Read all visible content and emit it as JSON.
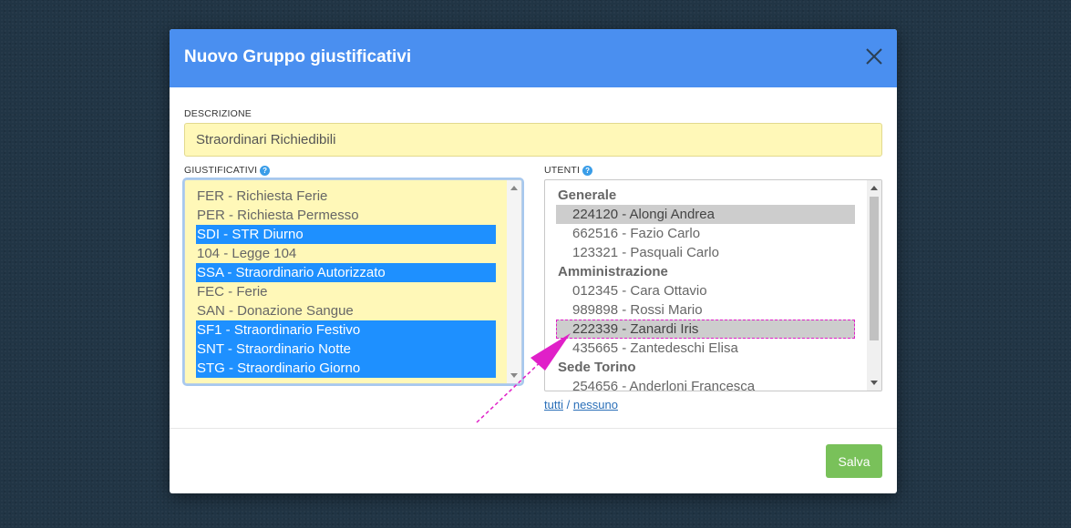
{
  "modal": {
    "title": "Nuovo Gruppo giustificativi"
  },
  "descrizione": {
    "label": "DESCRIZIONE",
    "value": "Straordinari Richiedibili"
  },
  "giustificativi": {
    "label": "GIUSTIFICATIVI",
    "options": [
      {
        "text": "FER - Richiesta Ferie",
        "selected": false
      },
      {
        "text": "PER - Richiesta Permesso",
        "selected": false
      },
      {
        "text": "SDI - STR Diurno",
        "selected": true
      },
      {
        "text": "104 - Legge 104",
        "selected": false
      },
      {
        "text": "SSA - Straordinario Autorizzato",
        "selected": true
      },
      {
        "text": "FEC - Ferie",
        "selected": false
      },
      {
        "text": "SAN - Donazione Sangue",
        "selected": false
      },
      {
        "text": "SF1 - Straordinario Festivo",
        "selected": true
      },
      {
        "text": "SNT - Straordinario Notte",
        "selected": true
      },
      {
        "text": "STG - Straordinario Giorno",
        "selected": true
      }
    ]
  },
  "utenti": {
    "label": "UTENTI",
    "groups": [
      {
        "name": "Generale",
        "users": [
          {
            "text": "224120 - Alongi Andrea",
            "selected": true
          },
          {
            "text": "662516 - Fazio Carlo",
            "selected": false
          },
          {
            "text": "123321 - Pasquali Carlo",
            "selected": false
          }
        ]
      },
      {
        "name": "Amministrazione",
        "users": [
          {
            "text": "012345 - Cara Ottavio",
            "selected": false
          },
          {
            "text": "989898 - Rossi Mario",
            "selected": false
          },
          {
            "text": "222339 - Zanardi Iris",
            "selected": true,
            "highlighted": true
          },
          {
            "text": "435665 - Zantedeschi Elisa",
            "selected": false
          }
        ]
      },
      {
        "name": "Sede Torino",
        "users": [
          {
            "text": "254656 - Anderloni Francesca",
            "selected": false
          }
        ]
      }
    ],
    "select_all": "tutti",
    "separator": "/",
    "select_none": "nessuno"
  },
  "footer": {
    "save_label": "Salva"
  },
  "colors": {
    "header": "#4a8ff0",
    "selection": "#1e90ff",
    "input_bg": "#fff8b8",
    "save_button": "#79c15a",
    "annotation": "#e020c8"
  },
  "icons": {
    "close": "close-icon",
    "help": "help-icon",
    "annotation": "arrow-annotation"
  }
}
